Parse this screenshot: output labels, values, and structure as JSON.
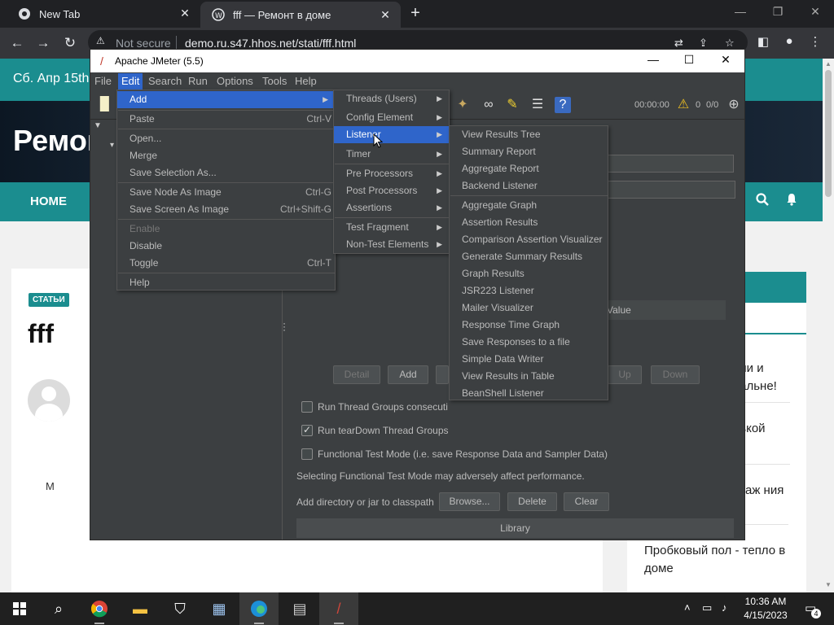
{
  "browser": {
    "tabs": [
      {
        "title": "New Tab",
        "icon": "chrome-icon",
        "active": false
      },
      {
        "title": "fff — Ремонт в доме",
        "icon": "wordpress-icon",
        "active": true
      }
    ],
    "security": "Not secure",
    "url": "demo.ru.s47.hhos.net/stati/fff.html",
    "window_controls": {
      "minimize": "—",
      "maximize": "❐",
      "close": "✕"
    }
  },
  "site": {
    "date": "Сб. Апр 15th",
    "hero_title": "Ремон",
    "nav_home": "HOME",
    "badge": "СТАТЬИ",
    "article_title": "fff",
    "author_initial": "M",
    "sidebar_items": [
      "нии и пальне!",
      "нькой",
      "нтаж ния",
      "Пробковый пол - тепло в доме"
    ]
  },
  "jmeter": {
    "title": "Apache JMeter (5.5)",
    "menus": [
      "File",
      "Edit",
      "Search",
      "Run",
      "Options",
      "Tools",
      "Help"
    ],
    "active_menu": "Edit",
    "timer": "00:00:00",
    "warnings": "0",
    "threads": "0/0",
    "table_header_value": "Value",
    "buttons_row": [
      "Detail",
      "Add",
      "Up",
      "Down"
    ],
    "checkboxes": [
      {
        "label": "Run Thread Groups consecutiv",
        "checked": false
      },
      {
        "label": "Run tearDown Thread Groups a",
        "checked": true
      },
      {
        "label": "Functional Test Mode (i.e. save Response Data and Sampler Data)",
        "checked": false
      }
    ],
    "functional_note": "Selecting Functional Test Mode may adversely affect performance.",
    "classpath_label": "Add directory or jar to classpath",
    "classpath_buttons": [
      "Browse...",
      "Delete",
      "Clear"
    ],
    "library_header": "Library"
  },
  "edit_menu": {
    "items": [
      {
        "label": "Add",
        "accel": "",
        "submenu": true,
        "selected": true,
        "disabled": false
      },
      {
        "label": "Paste",
        "accel": "Ctrl-V",
        "submenu": false,
        "selected": false,
        "disabled": false
      },
      {
        "label": "Open...",
        "accel": "",
        "submenu": false,
        "selected": false,
        "disabled": false
      },
      {
        "label": "Merge",
        "accel": "",
        "submenu": false,
        "selected": false,
        "disabled": false
      },
      {
        "label": "Save Selection As...",
        "accel": "",
        "submenu": false,
        "selected": false,
        "disabled": false
      },
      {
        "label": "Save Node As Image",
        "accel": "Ctrl-G",
        "submenu": false,
        "selected": false,
        "disabled": false
      },
      {
        "label": "Save Screen As Image",
        "accel": "Ctrl+Shift-G",
        "submenu": false,
        "selected": false,
        "disabled": false
      },
      {
        "label": "Enable",
        "accel": "",
        "submenu": false,
        "selected": false,
        "disabled": true
      },
      {
        "label": "Disable",
        "accel": "",
        "submenu": false,
        "selected": false,
        "disabled": false
      },
      {
        "label": "Toggle",
        "accel": "Ctrl-T",
        "submenu": false,
        "selected": false,
        "disabled": false
      },
      {
        "label": "Help",
        "accel": "",
        "submenu": false,
        "selected": false,
        "disabled": false
      }
    ]
  },
  "add_menu": {
    "items": [
      {
        "label": "Threads (Users)",
        "selected": false
      },
      {
        "label": "Config Element",
        "selected": false
      },
      {
        "label": "Listener",
        "selected": true
      },
      {
        "label": "Timer",
        "selected": false
      },
      {
        "label": "Pre Processors",
        "selected": false
      },
      {
        "label": "Post Processors",
        "selected": false
      },
      {
        "label": "Assertions",
        "selected": false
      },
      {
        "label": "Test Fragment",
        "selected": false
      },
      {
        "label": "Non-Test Elements",
        "selected": false
      }
    ]
  },
  "listener_menu": {
    "items": [
      "View Results Tree",
      "Summary Report",
      "Aggregate Report",
      "Backend Listener",
      "Aggregate Graph",
      "Assertion Results",
      "Comparison Assertion Visualizer",
      "Generate Summary Results",
      "Graph Results",
      "JSR223 Listener",
      "Mailer Visualizer",
      "Response Time Graph",
      "Save Responses to a file",
      "Simple Data Writer",
      "View Results in Table",
      "BeanShell Listener"
    ]
  },
  "taskbar": {
    "time": "10:36 AM",
    "date": "4/15/2023",
    "notifications": "4"
  },
  "colors": {
    "site_accent": "#1b8d8f",
    "jmeter_bg": "#3c3f41",
    "menu_selection": "#2f65ca"
  }
}
